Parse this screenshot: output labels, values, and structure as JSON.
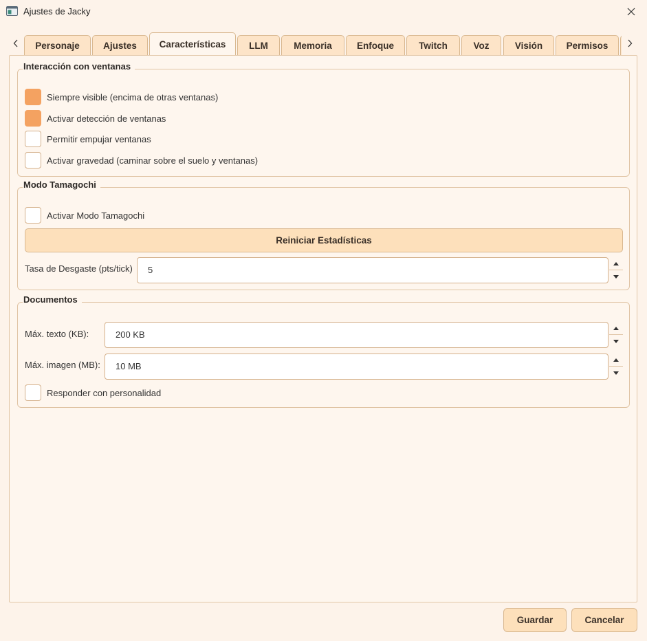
{
  "window": {
    "title": "Ajustes de Jacky"
  },
  "tabs": [
    {
      "label": "Personaje"
    },
    {
      "label": "Ajustes"
    },
    {
      "label": "Características",
      "active": true
    },
    {
      "label": "LLM"
    },
    {
      "label": "Memoria"
    },
    {
      "label": "Enfoque"
    },
    {
      "label": "Twitch"
    },
    {
      "label": "Voz"
    },
    {
      "label": "Visión"
    },
    {
      "label": "Permisos"
    }
  ],
  "window_interaction": {
    "title": "Interacción con ventanas",
    "options": [
      {
        "label": "Siempre visible (encima de otras ventanas)",
        "checked": true
      },
      {
        "label": "Activar detección de ventanas",
        "checked": true
      },
      {
        "label": "Permitir empujar ventanas",
        "checked": false
      },
      {
        "label": "Activar gravedad (caminar sobre el suelo y ventanas)",
        "checked": false
      }
    ]
  },
  "tamagotchi": {
    "title": "Modo Tamagochi",
    "enable_label": "Activar Modo Tamagochi",
    "enabled": false,
    "reset_button": "Reiniciar Estadísticas",
    "decay_label": "Tasa de Desgaste (pts/tick)",
    "decay_value": "5"
  },
  "documents": {
    "title": "Documentos",
    "max_text_label": "Máx. texto (KB):",
    "max_text_value": "200 KB",
    "max_image_label": "Máx. imagen (MB):",
    "max_image_value": "10 MB",
    "personality_label": "Responder con personalidad",
    "personality_checked": false
  },
  "footer": {
    "save": "Guardar",
    "cancel": "Cancelar"
  },
  "colors": {
    "accent": "#f4a261",
    "background": "#fef6ee",
    "button": "#fde0bb",
    "border": "#d9b890"
  },
  "icons": {
    "app": "app-window-icon",
    "close": "close-icon",
    "tab_left": "chevron-left-icon",
    "tab_right": "chevron-right-icon",
    "spin_up": "caret-up-icon",
    "spin_down": "caret-down-icon"
  }
}
